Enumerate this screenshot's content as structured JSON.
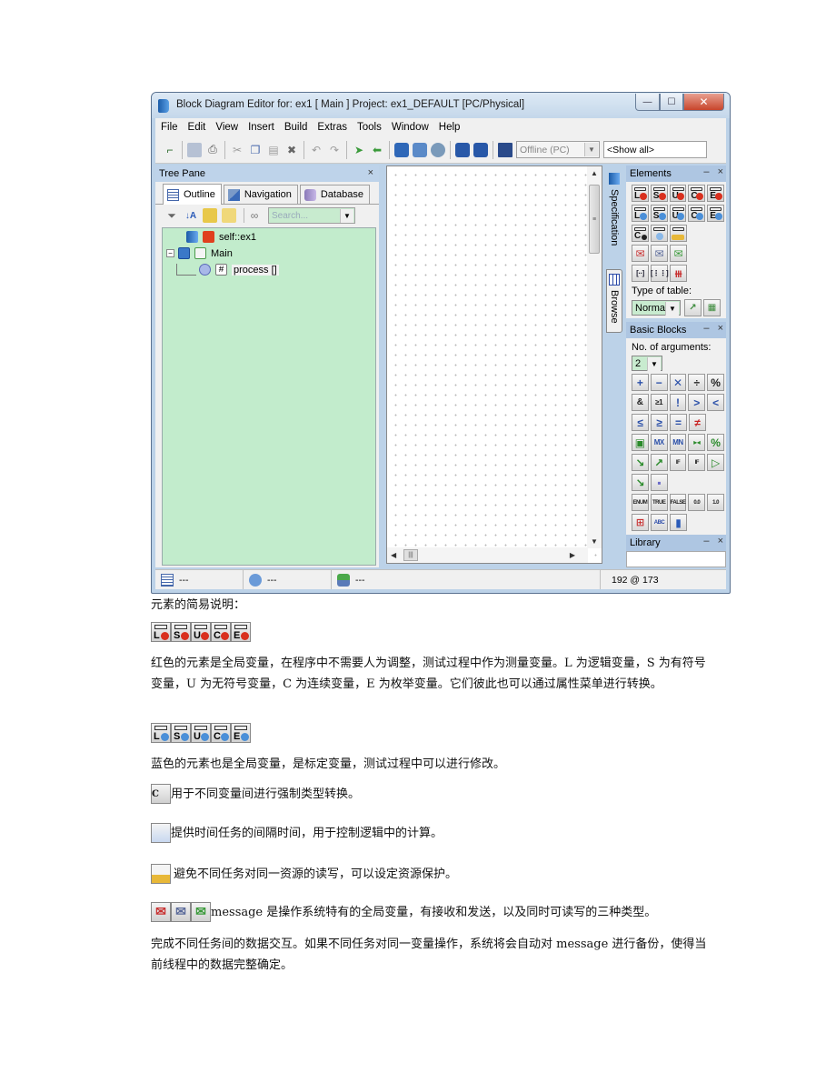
{
  "window": {
    "title": "Block Diagram Editor for: ex1 [ Main ] Project: ex1_DEFAULT [PC/Physical]",
    "controls": {
      "minimize": "—",
      "maximize": "☐",
      "close": "✕"
    }
  },
  "menu": [
    "File",
    "Edit",
    "View",
    "Insert",
    "Build",
    "Extras",
    "Tools",
    "Window",
    "Help"
  ],
  "toolbar": {
    "icons": [
      "connect-icon",
      "save-icon",
      "print-icon",
      "cut-icon",
      "copy-icon",
      "paste-icon",
      "delete-icon",
      "undo-icon",
      "redo-icon",
      "forward-icon",
      "back-icon",
      "build-icon",
      "generate-icon",
      "search-project-icon",
      "import-icon",
      "export-icon",
      "target-icon"
    ],
    "target_value": "Offline (PC)",
    "filter_value": "<Show all>"
  },
  "tree_pane": {
    "title": "Tree Pane",
    "close": "×",
    "tabs": [
      {
        "label": "Outline",
        "icon": "outline-icon",
        "active": true
      },
      {
        "label": "Navigation",
        "icon": "navigation-icon",
        "active": false
      },
      {
        "label": "Database",
        "icon": "database-icon",
        "active": false
      }
    ],
    "search_placeholder": "Search...",
    "nodes": [
      {
        "label": "self::ex1",
        "icon": "module-icon"
      },
      {
        "label": "Main",
        "icon": "diagram-icon",
        "expander": "−"
      },
      {
        "label": "process []",
        "icon": "process-icon"
      }
    ]
  },
  "side_tabs": [
    "Specification",
    "Browse"
  ],
  "elements_panel": {
    "title": "Elements",
    "minimize": "–",
    "close": "×",
    "measure_vars": [
      "L",
      "S",
      "U",
      "C",
      "E"
    ],
    "calib_vars": [
      "L",
      "S",
      "U",
      "C",
      "E"
    ],
    "type_of_table_label": "Type of table:",
    "type_of_table_value": "Normal",
    "colors": {
      "measure": "#d9301e",
      "calibration": "#4a8fd8"
    }
  },
  "basic_blocks_panel": {
    "title": "Basic Blocks",
    "minimize": "–",
    "close": "×",
    "args_label": "No. of arguments:",
    "args_value": "2",
    "rows": [
      [
        "+",
        "−",
        "✕",
        "÷",
        "%"
      ],
      [
        "&",
        "≥1",
        "!",
        ">",
        "<"
      ],
      [
        "≤",
        "≥",
        "=",
        "≠"
      ],
      [
        "▣",
        "MX",
        "MN",
        "▸◂",
        "%"
      ],
      [
        "↘",
        "↗",
        "IF",
        "IF",
        "▷"
      ],
      [
        "↘",
        "▪"
      ],
      [
        "ENUM",
        "TRUE",
        "FALSE",
        "0.0",
        "1.0"
      ],
      [
        "⊞",
        "ABC",
        "▮"
      ]
    ]
  },
  "library_panel": {
    "title": "Library",
    "minimize": "–",
    "close": "×"
  },
  "status": {
    "cell1": "---",
    "cell2": "---",
    "cell3": "---",
    "coords": "192 @ 173"
  },
  "doc": {
    "heading": "元素的简易说明：",
    "para_red": "红色的元素是全局变量，在程序中不需要人为调整，测试过程中作为测量变量。L 为逻辑变量，S 为有符号变量，U 为无符号变量，C 为连续变量，E 为枚举变量。它们彼此也可以通过属性菜单进行转换。",
    "para_blue": "蓝色的元素也是全局变量，是标定变量，测试过程中可以进行修改。",
    "para_cast": "用于不同变量间进行强制类型转换。",
    "para_timer": "提供时间任务的间隔时间，用于控制逻辑中的计算。",
    "para_resource": "避免不同任务对同一资源的读写，可以设定资源保护。",
    "para_message_1": "message 是操作系统特有的全局变量，有接收和发送，以及同时可读写的三种类型。",
    "para_message_2": "完成不同任务间的数据交互。如果不同任务对同一变量操作，系统将会自动对 message 进行备份，使得当前线程中的数据完整确定。"
  }
}
